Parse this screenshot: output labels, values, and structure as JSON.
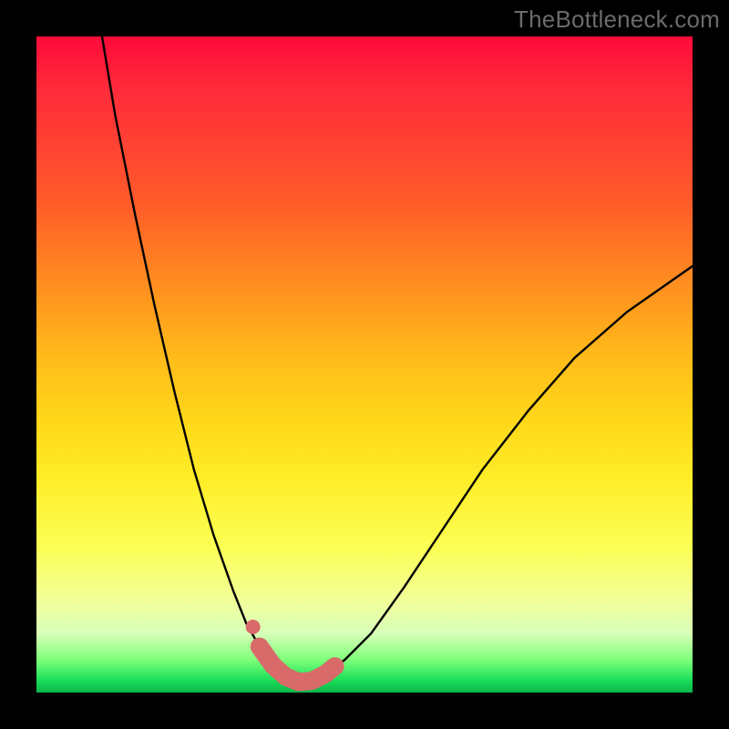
{
  "watermark": "TheBottleneck.com",
  "chart_data": {
    "type": "line",
    "title": "",
    "xlabel": "",
    "ylabel": "",
    "xlim": [
      0,
      100
    ],
    "ylim": [
      0,
      100
    ],
    "series": [
      {
        "name": "bottleneck-curve",
        "x": [
          10,
          12,
          15,
          18,
          21,
          24,
          27,
          30,
          32,
          34,
          36,
          37.5,
          39,
          40,
          42,
          44,
          47,
          51,
          56,
          62,
          68,
          75,
          82,
          90,
          100
        ],
        "y": [
          100,
          88,
          73,
          59,
          46,
          34,
          24,
          15.5,
          10.5,
          7,
          4.2,
          2.6,
          1.8,
          1.6,
          1.8,
          2.8,
          5,
          9,
          16,
          25,
          34,
          43,
          51,
          58,
          65
        ]
      },
      {
        "name": "highlight-band",
        "x": [
          34,
          36,
          38,
          40,
          42,
          44,
          45.5
        ],
        "y": [
          7,
          4.2,
          2.4,
          1.6,
          1.8,
          2.8,
          4
        ]
      },
      {
        "name": "highlight-dot",
        "x": [
          33
        ],
        "y": [
          10
        ]
      }
    ],
    "colors": {
      "curve": "#000000",
      "highlight": "#d96a6a",
      "gradient_top": "#ff0a3a",
      "gradient_bottom": "#0ab54a"
    }
  }
}
